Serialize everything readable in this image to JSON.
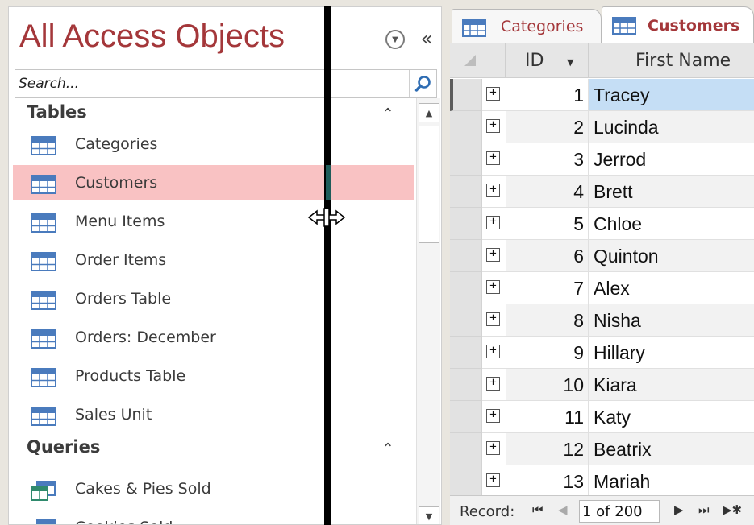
{
  "nav_pane": {
    "title": "All Access Objects",
    "search_placeholder": "Search...",
    "sections": [
      {
        "label": "Tables",
        "items": [
          {
            "label": "Categories",
            "icon": "table-icon"
          },
          {
            "label": "Customers",
            "icon": "table-icon",
            "selected": true
          },
          {
            "label": "Menu Items",
            "icon": "table-icon"
          },
          {
            "label": "Order Items",
            "icon": "table-icon"
          },
          {
            "label": "Orders Table",
            "icon": "table-icon"
          },
          {
            "label": "Orders: December",
            "icon": "table-icon"
          },
          {
            "label": "Products Table",
            "icon": "table-icon"
          },
          {
            "label": "Sales Unit",
            "icon": "table-icon"
          }
        ]
      },
      {
        "label": "Queries",
        "items": [
          {
            "label": "Cakes & Pies Sold",
            "icon": "query-icon"
          },
          {
            "label": "Cookies Sold",
            "icon": "query-icon"
          }
        ]
      }
    ]
  },
  "tabs": [
    {
      "label": "Categories",
      "active": false
    },
    {
      "label": "Customers",
      "active": true
    }
  ],
  "datasheet": {
    "columns": [
      "ID",
      "First Name"
    ],
    "rows": [
      {
        "id": "1",
        "first_name": "Tracey"
      },
      {
        "id": "2",
        "first_name": "Lucinda"
      },
      {
        "id": "3",
        "first_name": "Jerrod"
      },
      {
        "id": "4",
        "first_name": "Brett"
      },
      {
        "id": "5",
        "first_name": "Chloe"
      },
      {
        "id": "6",
        "first_name": "Quinton"
      },
      {
        "id": "7",
        "first_name": "Alex"
      },
      {
        "id": "8",
        "first_name": "Nisha"
      },
      {
        "id": "9",
        "first_name": "Hillary"
      },
      {
        "id": "10",
        "first_name": "Kiara"
      },
      {
        "id": "11",
        "first_name": "Katy"
      },
      {
        "id": "12",
        "first_name": "Beatrix"
      },
      {
        "id": "13",
        "first_name": "Mariah"
      }
    ]
  },
  "record_nav": {
    "label": "Record:",
    "position": "1 of 200"
  },
  "colors": {
    "accent": "#a4373a",
    "selection": "#f9c2c3",
    "cell_selection": "#c5def5"
  }
}
